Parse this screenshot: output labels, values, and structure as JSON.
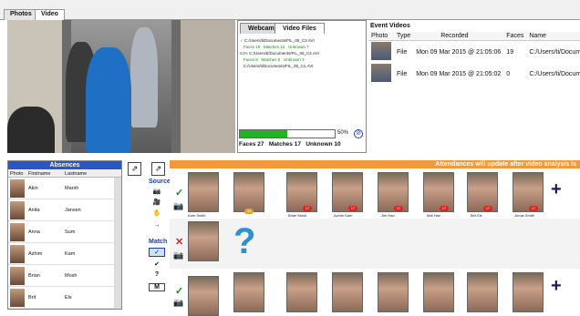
{
  "tabs": [
    "Photos",
    "Video"
  ],
  "video_subtabs": [
    "Webcams",
    "Video Files"
  ],
  "file_log": [
    {
      "path": "C:/Users/ti/Documents/FIL_05_C3.AVI",
      "faces": "Faces 19",
      "matches": "Matches 12",
      "unknown": "Unknown 7"
    },
    {
      "path": "C:/Users/ti/Documents/FIL_05_C2.AVI",
      "faces": "Faces 8",
      "matches": "Matches 5",
      "unknown": "Unknown 3"
    },
    {
      "path": "C:/Users/ti/Documents/FIL_05_C1.AVI",
      "faces": "",
      "matches": "",
      "unknown": ""
    }
  ],
  "file_pct": "53%",
  "progress": {
    "percent_label": "50%",
    "value": 0.5
  },
  "stats": {
    "faces": "Faces 27",
    "matches": "Matches 17",
    "unknown": "Unknown 10"
  },
  "event_videos": {
    "title": "Event Videos",
    "columns": [
      "Photo",
      "Type",
      "Recorded",
      "Faces",
      "Name"
    ],
    "rows": [
      {
        "type": "File",
        "recorded": "Mon 09 Mar 2015 @ 21:05:06",
        "faces": "19",
        "name": "C:/Users/ti/Documents"
      },
      {
        "type": "File",
        "recorded": "Mon 09 Mar 2015 @ 21:05:02",
        "faces": "0",
        "name": "C:/Users/ti/Documents"
      }
    ]
  },
  "absences": {
    "title": "Absences",
    "columns": [
      "Photo",
      "Firstname",
      "Lastname"
    ],
    "rows": [
      {
        "first": "Akin",
        "last": "Marsh"
      },
      {
        "first": "Anita",
        "last": "Jansen"
      },
      {
        "first": "Anna",
        "last": "Sum"
      },
      {
        "first": "Azhim",
        "last": "Kam"
      },
      {
        "first": "Brian",
        "last": "Mosh"
      },
      {
        "first": "Brit",
        "last": "Els"
      }
    ]
  },
  "side_tools": {
    "source_label": "Source",
    "match_label": "Match",
    "m_label": "M",
    "q_label": "?"
  },
  "attendance_banner": "Attendances will update after video analysis is",
  "row1_names": [
    "Kam Smith",
    "Brian Mosh",
    "Azhim Kam",
    "Jim Han",
    "Mat Han",
    "Brit Els",
    "Jonas Smith"
  ],
  "row1_badge": "33",
  "row_badges": [
    "17",
    "17",
    "17",
    "17",
    "17",
    "17"
  ],
  "colors": {
    "accent_blue": "#2a56c6",
    "banner_orange": "#f29a3a",
    "badge_red": "#d8261f",
    "progress_green": "#22b322"
  }
}
